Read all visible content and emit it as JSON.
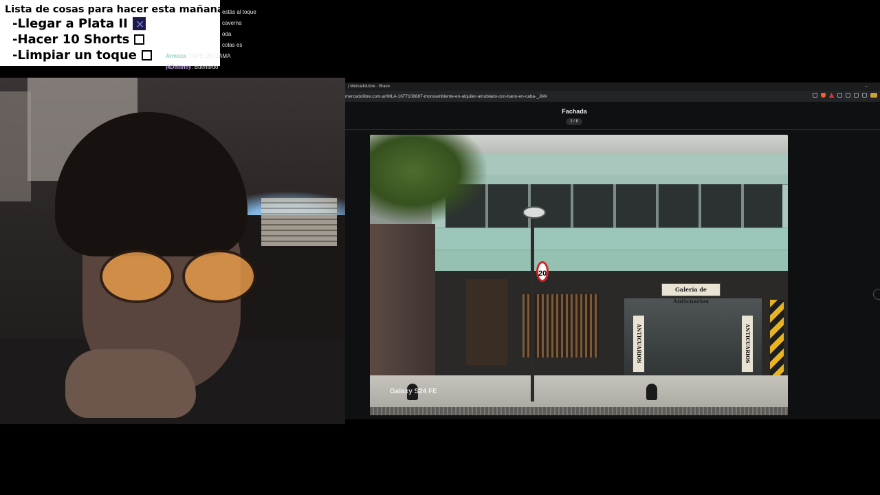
{
  "todo": {
    "title": "Lista de cosas para hacer esta mañana",
    "items": [
      {
        "label": "-Llegar a Plata II",
        "checked": true
      },
      {
        "label": "-Hacer 10 Shorts",
        "checked": false
      },
      {
        "label": "-Limpiar un toque",
        "checked": false
      }
    ]
  },
  "chat": {
    "lines": [
      {
        "text": "estás al toque"
      },
      {
        "text": "caverna"
      },
      {
        "text": "oda"
      },
      {
        "text": ""
      },
      {
        "text": "colas es"
      },
      {
        "text": ""
      },
      {
        "user": "Armoza",
        "user_color": "#8fd1c9",
        "message": ": TOPE DE GAMA"
      },
      {
        "user": "jkDelaney",
        "user_color": "#c9a7e8",
        "message": ": Buenardo"
      }
    ]
  },
  "browser": {
    "window_title": "| MercadoLibre - Brave",
    "minimize": "–",
    "url": "mercadolibre.com.ar/MLA-1677108887-monoambiente-en-alquiler-amoblado-con-bano-en-caba-_JM#",
    "viewer": {
      "title": "Fachada",
      "counter": "2 / 8"
    },
    "photo": {
      "watermark": "Galaxy S24 FE",
      "speed_sign": "20",
      "store_sign": "Galería de Anticuarios",
      "vertical_sign_left": "ANTICUARIOS",
      "vertical_sign_right": "ANTICUARIOS"
    }
  },
  "icons": [
    "share-icon",
    "brave-shields-icon",
    "brave-rewards-icon",
    "extensions-icon",
    "sidebar-icon",
    "wallet-icon",
    "menu-icon",
    "checked-box-icon",
    "empty-checkbox-icon"
  ]
}
